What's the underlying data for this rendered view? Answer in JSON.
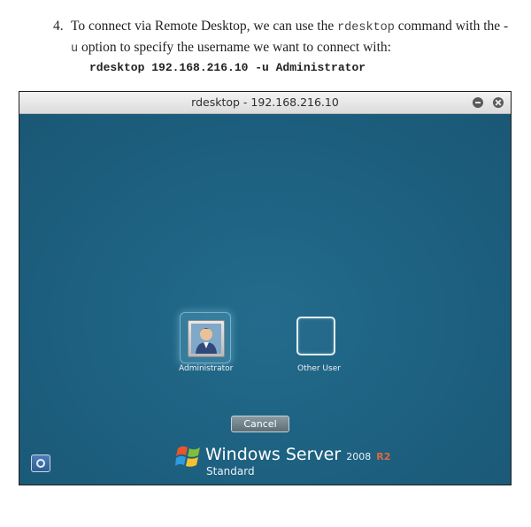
{
  "document": {
    "step_number": "4.",
    "text_part1": "To connect via Remote Desktop, we can use the ",
    "inline_command": "rdesktop",
    "text_part2": " command with the -",
    "inline_option": "u",
    "text_part3": " option to specify the username we want to connect with:",
    "command_block": "rdesktop 192.168.216.10 -u Administrator"
  },
  "window": {
    "title": "rdesktop - 192.168.216.10",
    "minimize_icon": "minimize-icon",
    "close_icon": "close-icon"
  },
  "login_screen": {
    "users": [
      {
        "label": "Administrator",
        "icon": "user-avatar-icon",
        "selected": true
      },
      {
        "label": "Other User",
        "icon": "blank-user-icon",
        "selected": false
      }
    ],
    "cancel_label": "Cancel",
    "ease_of_access_icon": "ease-of-access-icon",
    "brand": {
      "name": "Windows Server",
      "version": "2008",
      "release": "R2",
      "edition": "Standard",
      "logo_icon": "windows-flag-icon"
    }
  }
}
